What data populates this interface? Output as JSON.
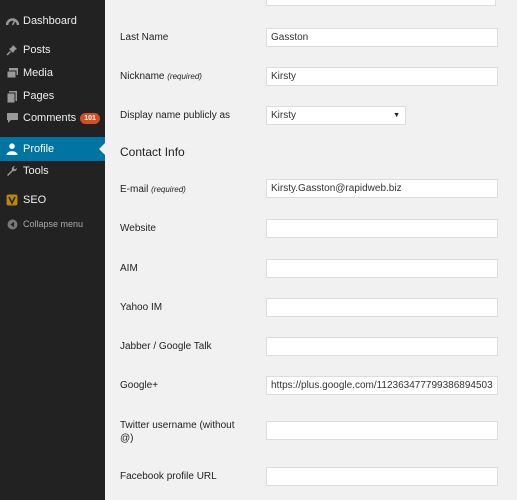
{
  "sidebar": {
    "items": [
      {
        "label": "Dashboard",
        "icon": "dashboard-icon"
      },
      {
        "label": "Posts",
        "icon": "pin-icon"
      },
      {
        "label": "Media",
        "icon": "media-icon"
      },
      {
        "label": "Pages",
        "icon": "pages-icon"
      },
      {
        "label": "Comments",
        "icon": "comment-icon",
        "badge": "101"
      },
      {
        "label": "Profile",
        "icon": "user-icon",
        "active": true
      },
      {
        "label": "Tools",
        "icon": "wrench-icon"
      },
      {
        "label": "SEO",
        "icon": "seo-icon"
      },
      {
        "label": "Collapse menu",
        "icon": "collapse-icon"
      }
    ]
  },
  "form": {
    "last_name": {
      "label": "Last Name",
      "value": "Gasston"
    },
    "nickname": {
      "label": "Nickname",
      "required": "(required)",
      "value": "Kirsty"
    },
    "display_name": {
      "label": "Display name publicly as",
      "value": "Kirsty"
    },
    "contact_heading": "Contact Info",
    "email": {
      "label": "E-mail",
      "required": "(required)",
      "value": "Kirsty.Gasston@rapidweb.biz"
    },
    "website": {
      "label": "Website",
      "value": ""
    },
    "aim": {
      "label": "AIM",
      "value": ""
    },
    "yahoo": {
      "label": "Yahoo IM",
      "value": ""
    },
    "jabber": {
      "label": "Jabber / Google Talk",
      "value": ""
    },
    "google_plus": {
      "label": "Google+",
      "value": "https://plus.google.com/112363477799386894503"
    },
    "twitter": {
      "label": "Twitter username (without @)",
      "value": ""
    },
    "facebook": {
      "label": "Facebook profile URL",
      "value": ""
    }
  },
  "colors": {
    "sidebar_bg": "#222222",
    "active_bg": "#0074a2",
    "badge_bg": "#d54e21",
    "content_bg": "#f1f1f1"
  }
}
